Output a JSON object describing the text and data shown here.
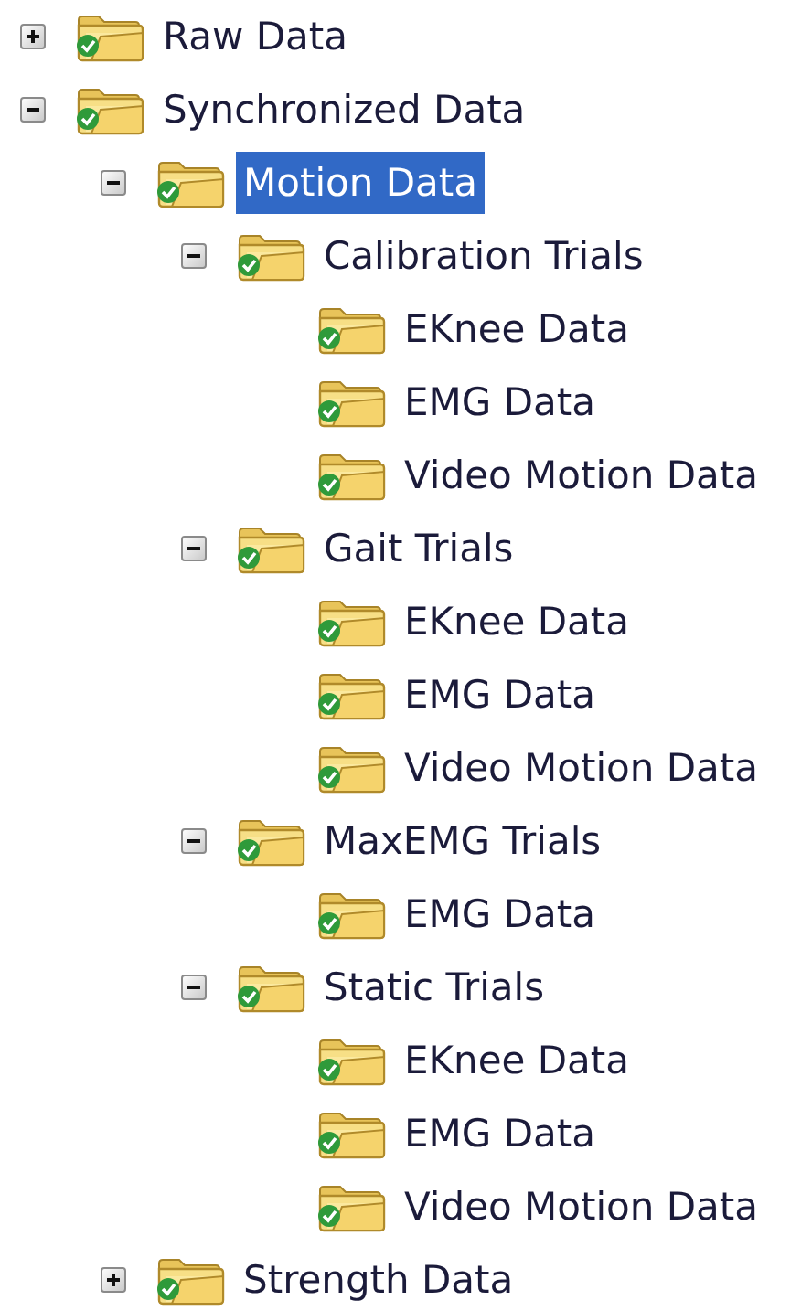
{
  "tree": [
    {
      "label": "Raw Data",
      "expanded": false,
      "selected": false
    },
    {
      "label": "Synchronized Data",
      "expanded": true,
      "selected": false,
      "children": [
        {
          "label": "Motion Data",
          "expanded": true,
          "selected": true,
          "children": [
            {
              "label": "Calibration Trials",
              "expanded": true,
              "selected": false,
              "children": [
                {
                  "label": "EKnee Data",
                  "selected": false
                },
                {
                  "label": "EMG Data",
                  "selected": false
                },
                {
                  "label": "Video Motion Data",
                  "selected": false
                }
              ]
            },
            {
              "label": "Gait Trials",
              "expanded": true,
              "selected": false,
              "children": [
                {
                  "label": "EKnee Data",
                  "selected": false
                },
                {
                  "label": "EMG Data",
                  "selected": false
                },
                {
                  "label": "Video Motion Data",
                  "selected": false
                }
              ]
            },
            {
              "label": "MaxEMG Trials",
              "expanded": true,
              "selected": false,
              "children": [
                {
                  "label": "EMG Data",
                  "selected": false
                }
              ]
            },
            {
              "label": "Static Trials",
              "expanded": true,
              "selected": false,
              "children": [
                {
                  "label": "EKnee Data",
                  "selected": false
                },
                {
                  "label": "EMG Data",
                  "selected": false
                },
                {
                  "label": "Video Motion Data",
                  "selected": false
                }
              ]
            }
          ]
        },
        {
          "label": "Strength Data",
          "expanded": false,
          "selected": false
        }
      ]
    }
  ]
}
